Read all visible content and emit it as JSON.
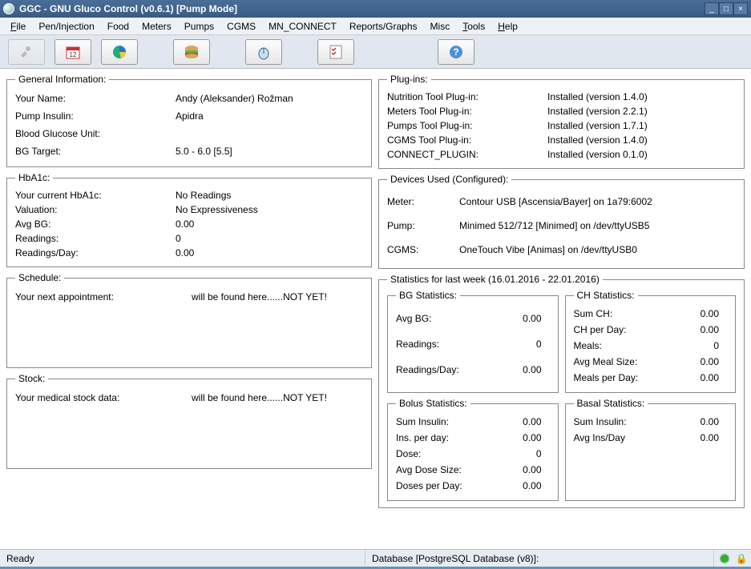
{
  "window": {
    "title": "GGC - GNU Gluco Control (v0.6.1) [Pump Mode]"
  },
  "menu": {
    "file": "File",
    "pen": "Pen/Injection",
    "food": "Food",
    "meters": "Meters",
    "pumps": "Pumps",
    "cgms": "CGMS",
    "mnconnect": "MN_CONNECT",
    "reports": "Reports/Graphs",
    "misc": "Misc",
    "tools": "Tools",
    "help": "Help"
  },
  "general": {
    "legend": "General Information:",
    "name_label": "Your Name:",
    "name_value": "Andy (Aleksander) Rožman",
    "insulin_label": "Pump Insulin:",
    "insulin_value": "Apidra",
    "bgunit_label": "Blood Glucose Unit:",
    "bgunit_value": "",
    "target_label": "BG Target:",
    "target_value": "5.0 - 6.0 [5.5]"
  },
  "hba1c": {
    "legend": "HbA1c:",
    "current_label": "Your current HbA1c:",
    "current_value": "No Readings",
    "valuation_label": "Valuation:",
    "valuation_value": "No Expressiveness",
    "avgbg_label": "Avg BG:",
    "avgbg_value": "0.00",
    "readings_label": "Readings:",
    "readings_value": "0",
    "rpd_label": "Readings/Day:",
    "rpd_value": "0.00"
  },
  "schedule": {
    "legend": "Schedule:",
    "label": "Your next appointment:",
    "value": "will be found here......NOT YET!"
  },
  "stock": {
    "legend": "Stock:",
    "label": "Your medical stock data:",
    "value": "will be found here......NOT YET!"
  },
  "plugins": {
    "legend": "Plug-ins:",
    "nutrition_label": "Nutrition Tool Plug-in:",
    "nutrition_value": "Installed (version 1.4.0)",
    "meters_label": "Meters Tool Plug-in:",
    "meters_value": "Installed (version 2.2.1)",
    "pumps_label": "Pumps Tool Plug-in:",
    "pumps_value": "Installed (version 1.7.1)",
    "cgms_label": "CGMS Tool Plug-in:",
    "cgms_value": "Installed (version 1.4.0)",
    "connect_label": "CONNECT_PLUGIN:",
    "connect_value": "Installed (version 0.1.0)"
  },
  "devices": {
    "legend": "Devices Used (Configured):",
    "meter_label": "Meter:",
    "meter_value": "Contour USB [Ascensia/Bayer] on 1a79:6002",
    "pump_label": "Pump:",
    "pump_value": "Minimed 512/712 [Minimed] on /dev/ttyUSB5",
    "cgms_label": "CGMS:",
    "cgms_value": "OneTouch Vibe [Animas] on /dev/ttyUSB0"
  },
  "stats": {
    "legend": "Statistics for last week (16.01.2016 - 22.01.2016)",
    "bg": {
      "legend": "BG Statistics:",
      "avgbg_label": "Avg BG:",
      "avgbg_value": "0.00",
      "readings_label": "Readings:",
      "readings_value": "0",
      "rpd_label": "Readings/Day:",
      "rpd_value": "0.00"
    },
    "ch": {
      "legend": "CH Statistics:",
      "sum_label": "Sum CH:",
      "sum_value": "0.00",
      "perday_label": "CH per Day:",
      "perday_value": "0.00",
      "meals_label": "Meals:",
      "meals_value": "0",
      "avgsize_label": "Avg Meal Size:",
      "avgsize_value": "0.00",
      "mpd_label": "Meals per Day:",
      "mpd_value": "0.00"
    },
    "bolus": {
      "legend": "Bolus Statistics:",
      "sum_label": "Sum Insulin:",
      "sum_value": "0.00",
      "perday_label": "Ins. per day:",
      "perday_value": "0.00",
      "dose_label": "Dose:",
      "dose_value": "0",
      "avgdose_label": "Avg Dose Size:",
      "avgdose_value": "0.00",
      "dpd_label": "Doses per Day:",
      "dpd_value": "0.00"
    },
    "basal": {
      "legend": "Basal Statistics:",
      "sum_label": "Sum Insulin:",
      "sum_value": "0.00",
      "avg_label": "Avg Ins/Day",
      "avg_value": "0.00"
    }
  },
  "status": {
    "ready": "Ready",
    "db": "Database [PostgreSQL Database (v8)]:"
  }
}
